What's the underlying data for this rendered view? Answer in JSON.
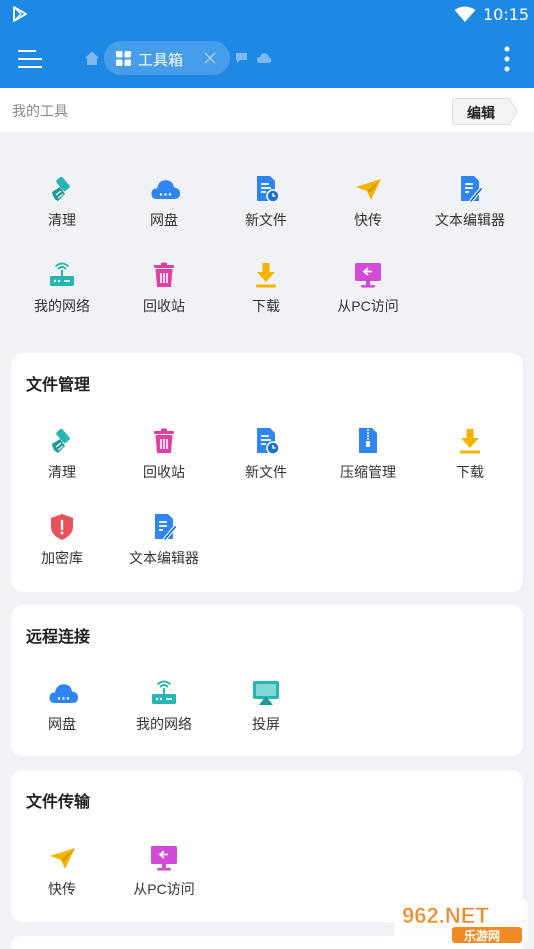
{
  "status": {
    "time": "10:15"
  },
  "header": {
    "tab_label": "工具箱"
  },
  "my_tools": {
    "title": "我的工具",
    "edit_label": "编辑",
    "row1": [
      {
        "label": "清理",
        "icon": "broom-icon"
      },
      {
        "label": "网盘",
        "icon": "cloud-icon"
      },
      {
        "label": "新文件",
        "icon": "new-file-icon"
      },
      {
        "label": "快传",
        "icon": "paper-plane-icon"
      },
      {
        "label": "文本编辑器",
        "icon": "text-editor-icon"
      }
    ],
    "row2": [
      {
        "label": "我的网络",
        "icon": "router-icon"
      },
      {
        "label": "回收站",
        "icon": "trash-icon"
      },
      {
        "label": "下载",
        "icon": "download-icon"
      },
      {
        "label": "从PC访问",
        "icon": "pc-access-icon"
      }
    ]
  },
  "file_mgmt": {
    "title": "文件管理",
    "row1": [
      {
        "label": "清理",
        "icon": "broom-icon"
      },
      {
        "label": "回收站",
        "icon": "trash-icon"
      },
      {
        "label": "新文件",
        "icon": "new-file-icon"
      },
      {
        "label": "压缩管理",
        "icon": "zip-icon"
      },
      {
        "label": "下载",
        "icon": "download-icon"
      }
    ],
    "row2": [
      {
        "label": "加密库",
        "icon": "shield-icon"
      },
      {
        "label": "文本编辑器",
        "icon": "text-editor-icon"
      }
    ]
  },
  "remote": {
    "title": "远程连接",
    "items": [
      {
        "label": "网盘",
        "icon": "cloud-icon"
      },
      {
        "label": "我的网络",
        "icon": "router-icon"
      },
      {
        "label": "投屏",
        "icon": "cast-screen-icon"
      }
    ]
  },
  "transfer": {
    "title": "文件传输",
    "items": [
      {
        "label": "快传",
        "icon": "paper-plane-icon"
      },
      {
        "label": "从PC访问",
        "icon": "pc-access-icon"
      }
    ]
  },
  "watermark": {
    "line1": "962.NET",
    "line2": "乐游网"
  },
  "colors": {
    "primary": "#1e88e5",
    "background": "#f0f2f5",
    "teal": "#26b5b0",
    "yellow": "#f5b400",
    "pink": "#e040a0",
    "red": "#e8505b"
  }
}
